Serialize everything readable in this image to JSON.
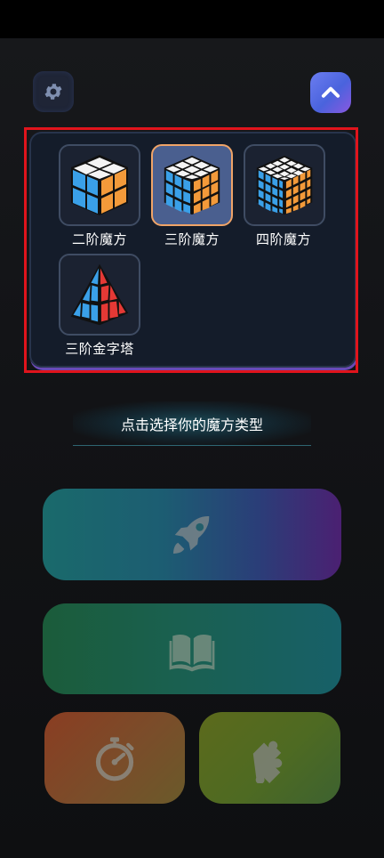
{
  "cube_types": [
    {
      "label": "二阶魔方",
      "icon": "cube-2x2-icon",
      "selected": false
    },
    {
      "label": "三阶魔方",
      "icon": "cube-3x3-icon",
      "selected": true
    },
    {
      "label": "四阶魔方",
      "icon": "cube-4x4-icon",
      "selected": false
    },
    {
      "label": "三阶金字塔",
      "icon": "pyramid-icon",
      "selected": false
    }
  ],
  "hint": "点击选择你的魔方类型",
  "toolbar": {
    "settings_icon": "gear-icon",
    "collapse_icon": "chevron-up-icon"
  },
  "actions": [
    {
      "icon": "rocket-icon"
    },
    {
      "icon": "book-icon"
    },
    {
      "icon": "stopwatch-icon"
    },
    {
      "icon": "puzzle-piece-icon"
    }
  ],
  "colors": {
    "accent": "#5b6ee8",
    "selected_border": "#f0a468",
    "highlight_frame": "#e0141c",
    "cube_blue": "#3aa0e8",
    "cube_orange": "#f39a3a",
    "cube_white": "#f4f4f4",
    "pyramid_red": "#e53935"
  }
}
